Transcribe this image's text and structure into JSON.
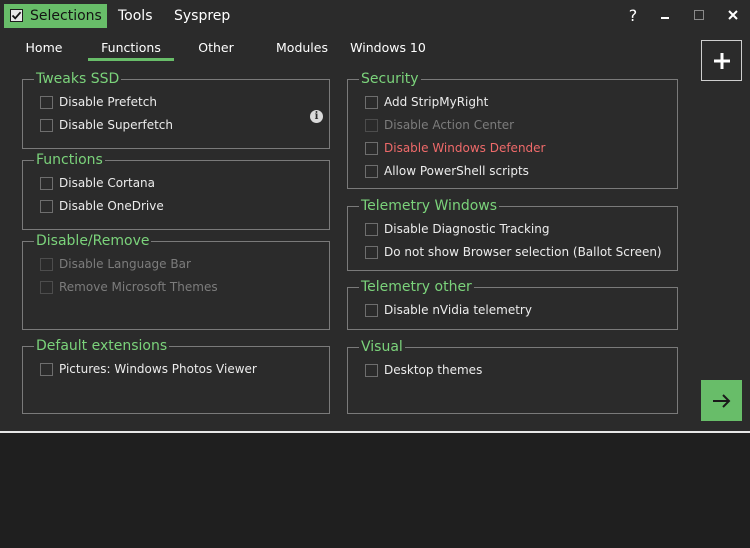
{
  "menu": {
    "selections_label": "Selections",
    "tools_label": "Tools",
    "sysprep_label": "Sysprep"
  },
  "window_controls": {
    "help": "?",
    "minimize": "–",
    "maximize": "☐",
    "close": "✕"
  },
  "tabs": [
    {
      "label": "Home",
      "active": false
    },
    {
      "label": "Functions",
      "active": true
    },
    {
      "label": "Other",
      "active": false
    },
    {
      "label": "Modules",
      "active": false
    },
    {
      "label": "Windows 10",
      "active": false
    }
  ],
  "groups": {
    "tweaks_ssd": {
      "title": "Tweaks SSD",
      "items": [
        {
          "label": "Disable Prefetch",
          "checked": false,
          "enabled": true
        },
        {
          "label": "Disable Superfetch",
          "checked": false,
          "enabled": true
        }
      ]
    },
    "functions": {
      "title": "Functions",
      "items": [
        {
          "label": "Disable Cortana",
          "checked": false,
          "enabled": true
        },
        {
          "label": "Disable OneDrive",
          "checked": false,
          "enabled": true
        }
      ]
    },
    "disable_remove": {
      "title": "Disable/Remove",
      "items": [
        {
          "label": "Disable Language Bar",
          "checked": false,
          "enabled": false
        },
        {
          "label": "Remove Microsoft Themes",
          "checked": false,
          "enabled": false
        }
      ]
    },
    "default_extensions": {
      "title": "Default extensions",
      "items": [
        {
          "label": "Pictures: Windows Photos Viewer",
          "checked": false,
          "enabled": true
        }
      ]
    },
    "security": {
      "title": "Security",
      "items": [
        {
          "label": "Add StripMyRight",
          "checked": false,
          "enabled": true
        },
        {
          "label": "Disable Action Center",
          "checked": false,
          "enabled": false
        },
        {
          "label": "Disable Windows Defender",
          "checked": false,
          "enabled": true,
          "warning": true
        },
        {
          "label": "Allow PowerShell scripts",
          "checked": false,
          "enabled": true
        }
      ]
    },
    "telemetry_windows": {
      "title": "Telemetry Windows",
      "items": [
        {
          "label": "Disable Diagnostic Tracking",
          "checked": false,
          "enabled": true
        },
        {
          "label": "Do not show Browser selection (Ballot Screen)",
          "checked": false,
          "enabled": true
        }
      ]
    },
    "telemetry_other": {
      "title": "Telemetry other",
      "items": [
        {
          "label": "Disable nVidia telemetry",
          "checked": false,
          "enabled": true
        }
      ]
    },
    "visual": {
      "title": "Visual",
      "items": [
        {
          "label": "Desktop themes",
          "checked": false,
          "enabled": true
        }
      ]
    }
  },
  "icons": {
    "info": "info-icon",
    "add": "plus-icon",
    "next": "arrow-right-icon"
  },
  "colors": {
    "accent": "#68bd69",
    "group_title": "#7bd37b",
    "warning": "#ef6a6a",
    "background": "#2b2b2b"
  }
}
